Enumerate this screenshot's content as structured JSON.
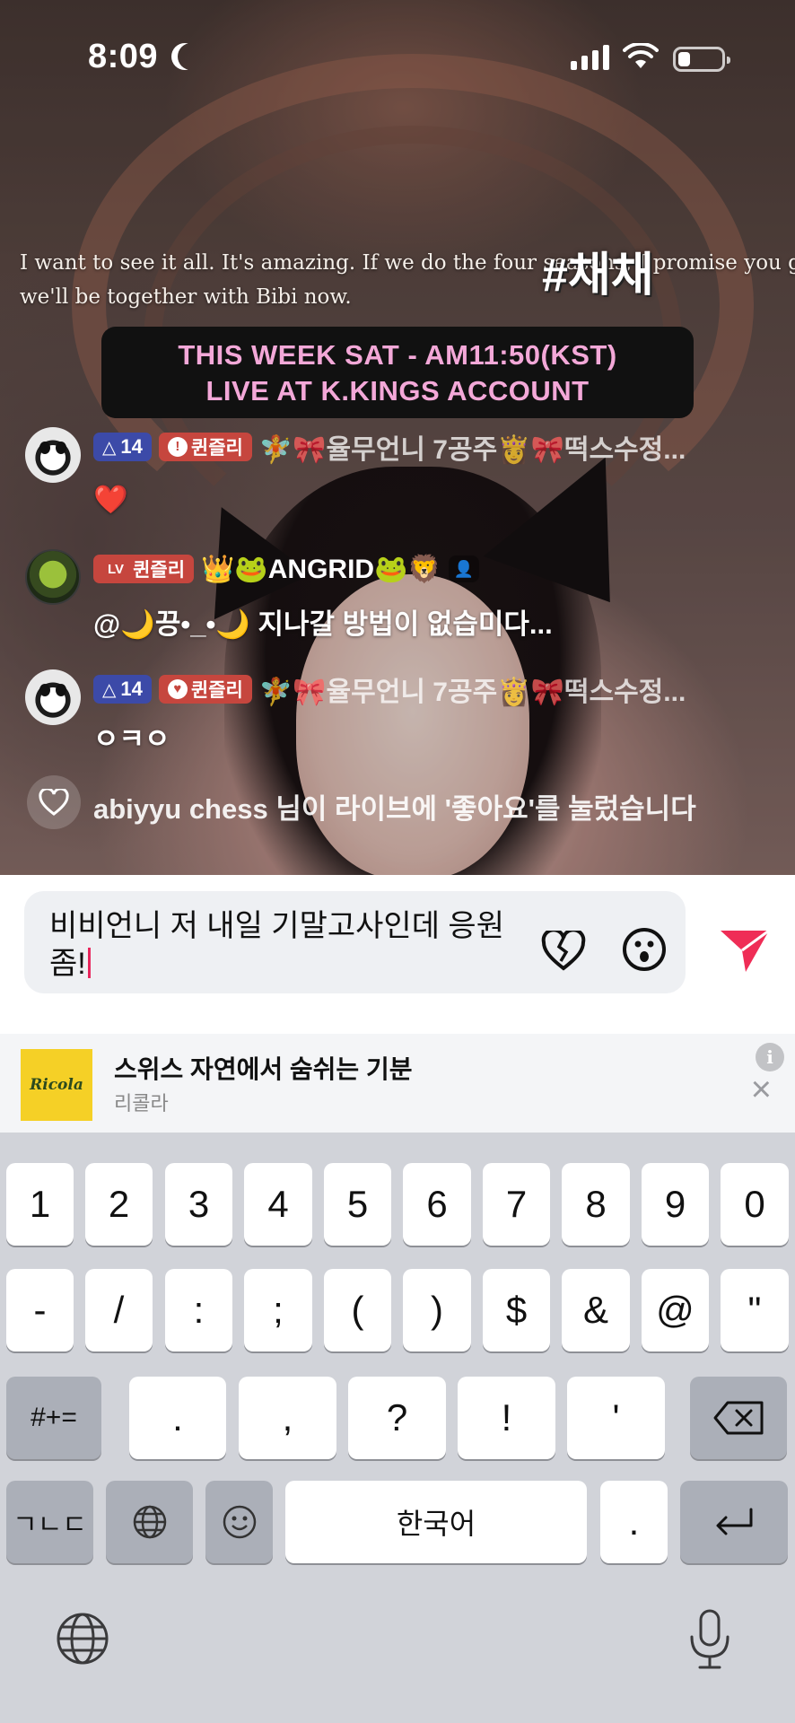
{
  "status_bar": {
    "time": "8:09",
    "moon_icon": "moon-icon",
    "signal_icon": "cellular-signal-icon",
    "wifi_icon": "wifi-icon",
    "battery_icon": "battery-low-icon"
  },
  "video": {
    "subtitle_line1": "I want to see it all. It's amazing. If we do the four seasons, I promise you gu",
    "subtitle_line2": "we'll be together with Bibi now.",
    "hashtag": "#채채",
    "promo_line1": "THIS WEEK SAT - AM11:50(KST)",
    "promo_line2": "LIVE AT K.KINGS ACCOUNT"
  },
  "comments": [
    {
      "level": "14",
      "fan_badge": "퀸즐리",
      "username": "🧚🎀율무언니 7공주👸🎀떡스수정...",
      "message": "❤️"
    },
    {
      "live_badge": "LV",
      "fan_badge": "퀸즐리",
      "username": "👑🐸ANGRID🐸🦁",
      "message": "@🌙끙•_•🌙 지나갈 방법이 없습미다..."
    },
    {
      "level": "14",
      "fan_badge": "퀸즐리",
      "username": "🧚🎀율무언니 7공주👸🎀떡스수정...",
      "message": "ㅇㅋㅇ"
    }
  ],
  "like_notice": "abiyyu chess 님이 라이브에 '좋아요'를 눌렀습니다",
  "composer": {
    "input_value": "비비언니 저 내일 기말고사인데 응원좀!",
    "heart_icon": "broken-heart-icon",
    "emoji_icon": "surprised-face-icon",
    "send_icon": "send-icon"
  },
  "ad": {
    "logo": "Ricola",
    "title": "스위스 자연에서 숨쉬는 기분",
    "subtitle": "리콜라",
    "info": "i",
    "close": "×"
  },
  "keyboard": {
    "row1": [
      "1",
      "2",
      "3",
      "4",
      "5",
      "6",
      "7",
      "8",
      "9",
      "0"
    ],
    "row2": [
      "-",
      "/",
      ":",
      ";",
      "(",
      ")",
      "$",
      "&",
      "@",
      "\""
    ],
    "row3_left": "#+=",
    "row3": [
      ".",
      ",",
      "?",
      "!",
      "'"
    ],
    "mode_key": "ㄱㄴㄷ",
    "space": "한국어",
    "period": ".",
    "backspace_icon": "backspace-icon",
    "return_icon": "return-icon",
    "globe_icon": "globe-icon",
    "emoji_icon": "emoji-icon",
    "mic_icon": "microphone-icon"
  }
}
